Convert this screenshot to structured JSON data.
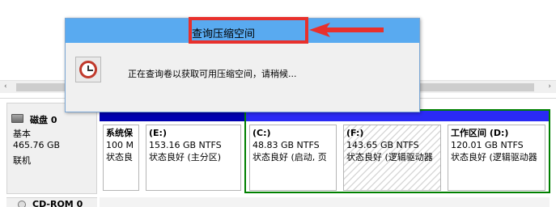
{
  "dialog": {
    "title": "查询压缩空间",
    "message": "正在查询卷以获取可用压缩空间，请稍候...",
    "icon": "stopwatch-icon"
  },
  "scrollbar": {
    "left_arrow": "‹",
    "right_arrow": "›"
  },
  "disk": {
    "name": "磁盘 0",
    "type": "基本",
    "size": "465.76 GB",
    "status": "联机"
  },
  "partitions": [
    {
      "title": "系统保",
      "size": "100 M",
      "status": "状态良",
      "kind": "primary"
    },
    {
      "title": "(E:)",
      "size": "153.16 GB NTFS",
      "status": "状态良好 (主分区)",
      "kind": "primary"
    },
    {
      "title": "(C:)",
      "size": "48.83 GB NTFS",
      "status": "状态良好 (启动, 页",
      "kind": "logical"
    },
    {
      "title": "(F:)",
      "size": "143.65 GB NTFS",
      "status": "状态良好 (逻辑驱动器",
      "kind": "logical",
      "selected": true
    },
    {
      "title": "工作区间  (D:)",
      "size": "120.01 GB NTFS",
      "status": "状态良好 (逻辑驱动器",
      "kind": "logical"
    }
  ],
  "cdrom": {
    "name": "CD-ROM 0"
  },
  "colors": {
    "primary_bar": "#0000b0",
    "logical_bar": "#2a2af5",
    "extended_border": "#008000",
    "title_bar": "#59aaf0",
    "annotation": "#e8302c"
  }
}
